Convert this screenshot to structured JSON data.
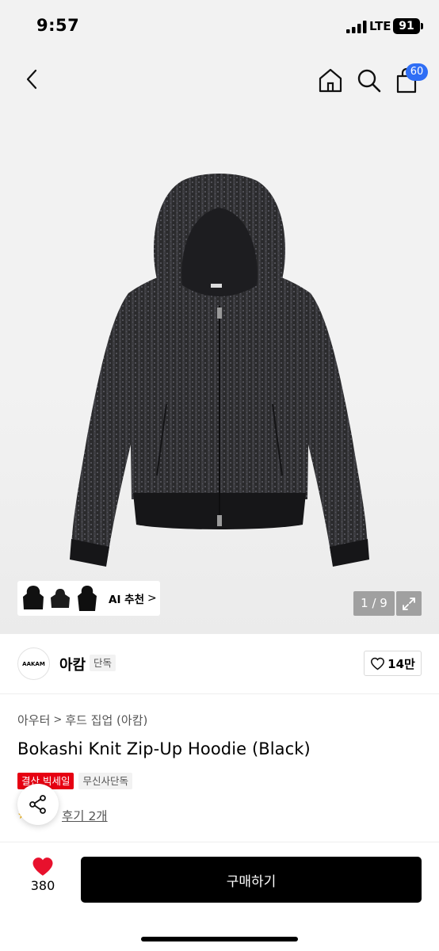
{
  "status_bar": {
    "time": "9:57",
    "network": "LTE",
    "battery": "91"
  },
  "nav": {
    "cart_count": "60"
  },
  "gallery": {
    "ai_label": "AI 추천",
    "ai_chevron": ">",
    "page_counter": "1 / 9"
  },
  "brand": {
    "logo_text": "AAKAM",
    "name": "아캄",
    "tag": "단독",
    "like_count": "14만"
  },
  "product": {
    "breadcrumb": [
      "아우터",
      "후드 집업 (아캄)"
    ],
    "breadcrumb_sep": ">",
    "title": "Bokashi Knit Zip-Up Hoodie (Black)",
    "tags": [
      "결산 빅세일",
      "무신사단독"
    ],
    "review_link": "후기 2개"
  },
  "bottom_bar": {
    "wish_count": "380",
    "buy_label": "구매하기"
  },
  "colors": {
    "accent_blue": "#2f6ef5",
    "sale_red": "#e60012",
    "heart_red": "#e8112d",
    "buy_black": "#000000"
  },
  "icons": [
    "back-icon",
    "home-icon",
    "search-icon",
    "cart-icon",
    "expand-icon",
    "heart-outline-icon",
    "share-icon",
    "heart-filled-icon"
  ]
}
